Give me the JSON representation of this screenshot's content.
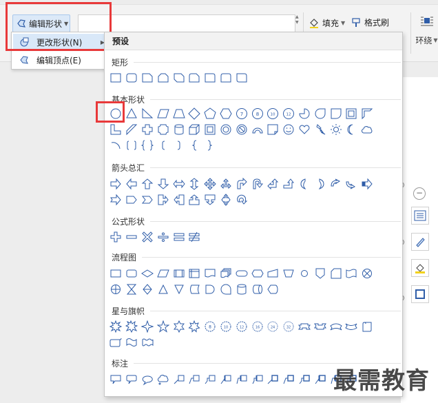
{
  "ribbon": {
    "edit_shape_label": "编辑形状",
    "fill_label": "填充",
    "format_brush_label": "格式刷",
    "surround_label": "环绕"
  },
  "submenu": {
    "change_shape": "更改形状(N)",
    "edit_points": "编辑顶点(E)"
  },
  "panel": {
    "title": "预设",
    "categories": {
      "rect": "矩形",
      "basic": "基本形状",
      "arrows": "箭头总汇",
      "formula": "公式形状",
      "flowchart": "流程图",
      "stars": "星与旗帜",
      "callouts": "标注"
    }
  },
  "watermark": "最需教育",
  "colors": {
    "accent": "#2f5da8",
    "highlight": "#e8393a",
    "selected_bg": "#d9e8f8"
  }
}
